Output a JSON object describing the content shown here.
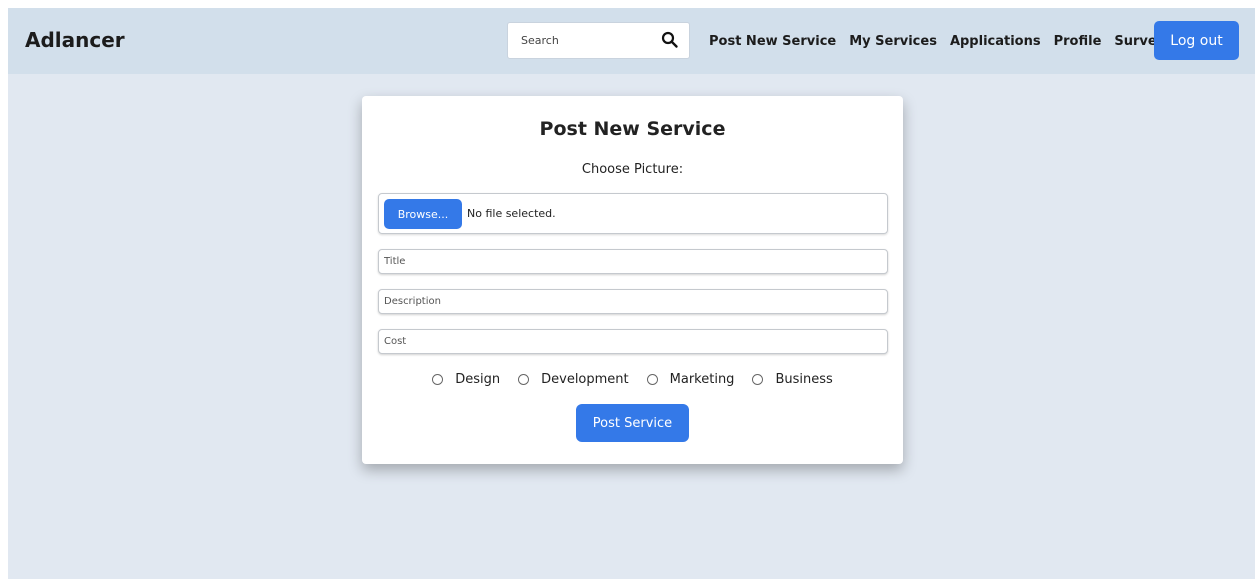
{
  "navbar": {
    "brand": "Adlancer",
    "search": {
      "placeholder": "Search",
      "icon": "magnifier"
    },
    "links": [
      "Post New Service",
      "My Services",
      "Applications",
      "Profile",
      "Survey"
    ],
    "logout_label": "Log out"
  },
  "form": {
    "title": "Post New Service",
    "choose_picture_label": "Choose Picture:",
    "file": {
      "browse_label": "Browse...",
      "status": "No file selected."
    },
    "title_placeholder": "Title",
    "description_placeholder": "Description",
    "cost_placeholder": "Cost",
    "categories": [
      "Design",
      "Development",
      "Marketing",
      "Business"
    ],
    "submit_label": "Post Service"
  },
  "colors": {
    "accent": "#3479e8",
    "navbar_bg": "#d2dfeb",
    "page_bg": "#e1e8f1"
  }
}
